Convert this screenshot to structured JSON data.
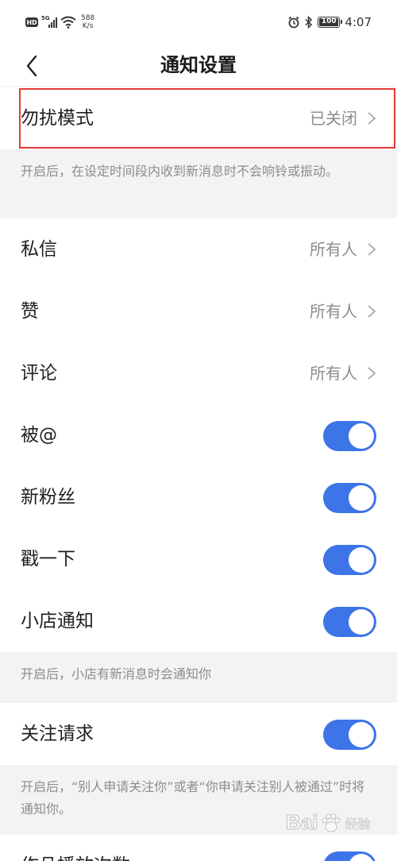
{
  "status_bar": {
    "hd_badge": "HD",
    "network": "5G",
    "speed_value": "588",
    "speed_unit": "K/s",
    "battery": "100",
    "time": "4:07"
  },
  "header": {
    "title": "通知设置"
  },
  "dnd": {
    "label": "勿扰模式",
    "value": "已关闭",
    "note": "开启后，在设定时间段内收到新消息时不会响铃或振动。"
  },
  "settings": [
    {
      "label": "私信",
      "value": "所有人"
    },
    {
      "label": "赞",
      "value": "所有人"
    },
    {
      "label": "评论",
      "value": "所有人"
    }
  ],
  "toggles": [
    {
      "label": "被@",
      "on": true
    },
    {
      "label": "新粉丝",
      "on": true
    },
    {
      "label": "戳一下",
      "on": true
    },
    {
      "label": "小店通知",
      "on": true
    }
  ],
  "shop_note": "开启后，小店有新消息时会通知你",
  "follow": {
    "label": "关注请求",
    "on": true,
    "note": "开启后，“别人申请关注你”或者“你申请关注别人被通过”时将通知你。"
  },
  "partial_row": {
    "label": "作品播放次数",
    "on": true
  },
  "watermark": {
    "logo": "Bai",
    "text": "经验"
  },
  "colors": {
    "toggle_on": "#3d74e8",
    "highlight": "#e53935"
  }
}
